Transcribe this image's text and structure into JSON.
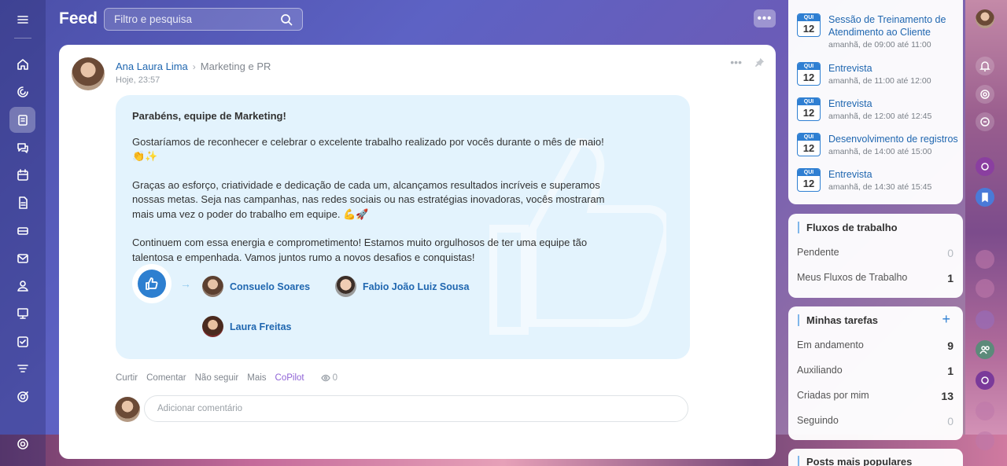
{
  "header": {
    "title": "Feed",
    "search_placeholder": "Filtro e pesquisa",
    "more_label": "•••"
  },
  "post": {
    "author": "Ana Laura Lima",
    "destination": "Marketing e PR",
    "time": "Hoje, 23:57",
    "title": "Parabéns, equipe de Marketing!",
    "paragraphs": [
      "Gostaríamos de reconhecer e celebrar o excelente trabalho realizado por vocês durante o mês de maio! 👏✨",
      "Graças ao esforço, criatividade e dedicação de cada um, alcançamos resultados incríveis e superamos nossas metas. Seja nas campanhas, nas redes sociais ou nas estratégias inovadoras, vocês mostraram mais uma vez o poder do trabalho em equipe. 💪🚀",
      "Continuem com essa energia e comprometimento! Estamos muito orgulhosos de ter uma equipe tão talentosa e empenhada. Vamos juntos rumo a novos desafios e conquistas!"
    ],
    "recipients": [
      "Consuelo Soares",
      "Fabio João Luiz Sousa",
      "Laura Freitas"
    ],
    "actions": {
      "like": "Curtir",
      "comment": "Comentar",
      "unfollow": "Não seguir",
      "more": "Mais",
      "copilot": "CoPilot",
      "views": "0"
    },
    "comment_placeholder": "Adicionar comentário"
  },
  "events": [
    {
      "weekday": "QUI",
      "day": "12",
      "title": "Sessão de Treinamento de Atendimento ao Cliente",
      "time": "amanhã, de 09:00 até 11:00"
    },
    {
      "weekday": "QUI",
      "day": "12",
      "title": "Entrevista",
      "time": "amanhã, de 11:00 até 12:00"
    },
    {
      "weekday": "QUI",
      "day": "12",
      "title": "Entrevista",
      "time": "amanhã, de 12:00 até 12:45"
    },
    {
      "weekday": "QUI",
      "day": "12",
      "title": "Desenvolvimento de registros",
      "time": "amanhã, de 14:00 até 15:00"
    },
    {
      "weekday": "QUI",
      "day": "12",
      "title": "Entrevista",
      "time": "amanhã, de 14:30 até 15:45"
    }
  ],
  "workflows": {
    "title": "Fluxos de trabalho",
    "rows": [
      {
        "label": "Pendente",
        "count": "0"
      },
      {
        "label": "Meus Fluxos de Trabalho",
        "count": "1"
      }
    ]
  },
  "tasks": {
    "title": "Minhas tarefas",
    "add": "+",
    "rows": [
      {
        "label": "Em andamento",
        "count": "9"
      },
      {
        "label": "Auxiliando",
        "count": "1"
      },
      {
        "label": "Criadas por mim",
        "count": "13"
      },
      {
        "label": "Seguindo",
        "count": "0"
      }
    ]
  },
  "popular": {
    "title": "Posts mais populares"
  },
  "colors": {
    "accent": "#2f7fd2",
    "link": "#2067b0",
    "copilot": "#8f63d6",
    "message_bg": "#e3f3fd"
  }
}
